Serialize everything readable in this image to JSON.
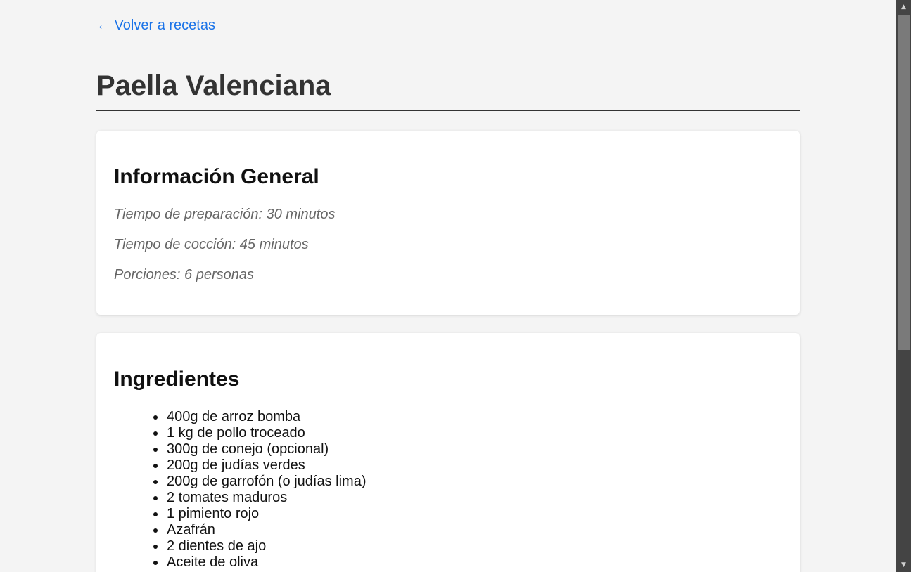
{
  "nav": {
    "back_link": "← Volver a recetas"
  },
  "recipe": {
    "title": "Paella Valenciana"
  },
  "general_info": {
    "heading": "Información General",
    "prep_time": "Tiempo de preparación: 30 minutos",
    "cook_time": "Tiempo de cocción: 45 minutos",
    "servings": "Porciones: 6 personas"
  },
  "ingredients": {
    "heading": "Ingredientes",
    "items": [
      "400g de arroz bomba",
      "1 kg de pollo troceado",
      "300g de conejo (opcional)",
      "200g de judías verdes",
      "200g de garrofón (o judías lima)",
      "2 tomates maduros",
      "1 pimiento rojo",
      "Azafrán",
      "2 dientes de ajo",
      "Aceite de oliva"
    ]
  },
  "colors": {
    "link": "#1a73e8",
    "title": "#333333",
    "background": "#f4f4f4",
    "card": "#ffffff"
  },
  "scrollbar": {
    "up_icon": "scroll-up-arrow-icon",
    "down_icon": "scroll-down-arrow-icon"
  }
}
